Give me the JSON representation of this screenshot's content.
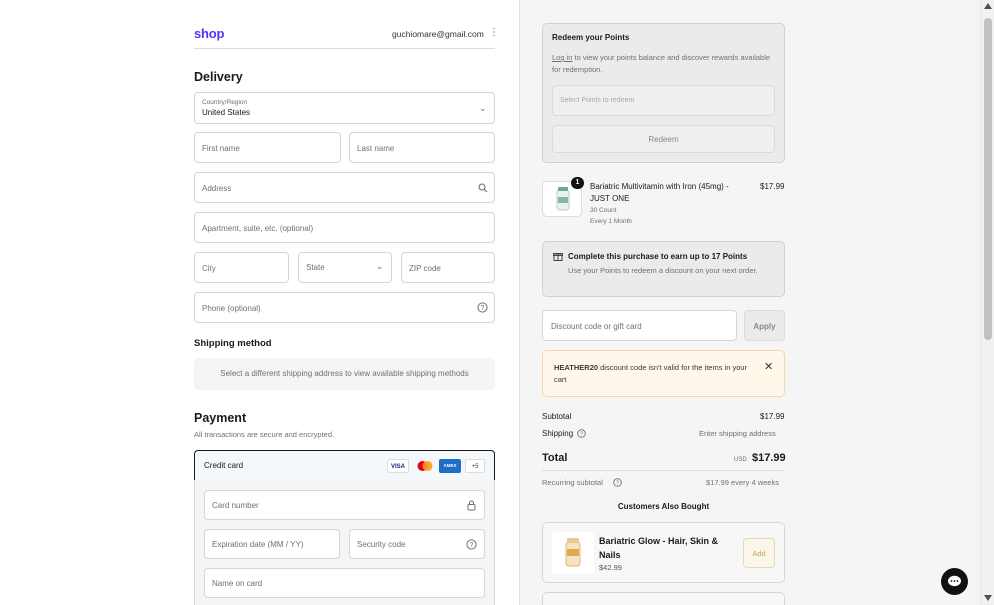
{
  "header": {
    "logo": "shop",
    "email": "guchiomare@gmail.com",
    "menu_icon": "kebab-icon"
  },
  "delivery": {
    "title": "Delivery",
    "country_label": "Country/Region",
    "country_value": "United States",
    "first_name_placeholder": "First name",
    "last_name_placeholder": "Last name",
    "address_placeholder": "Address",
    "apartment_placeholder": "Apartment, suite, etc. (optional)",
    "city_placeholder": "City",
    "state_placeholder": "State",
    "zip_placeholder": "ZIP code",
    "phone_placeholder": "Phone (optional)"
  },
  "shipping": {
    "title": "Shipping method",
    "message": "Select a different shipping address to view available shipping methods"
  },
  "payment": {
    "title": "Payment",
    "subtitle": "All transactions are secure and encrypted.",
    "method_label": "Credit card",
    "card_brands": [
      "VISA",
      "mastercard",
      "AMEX"
    ],
    "more_brands": "+5",
    "card_number_placeholder": "Card number",
    "expiration_placeholder": "Expiration date (MM / YY)",
    "security_code_placeholder": "Security code",
    "name_on_card_placeholder": "Name on card"
  },
  "points": {
    "title": "Redeem your Points",
    "login_link": "Log in",
    "description": " to view your points balance and discover rewards available for redemption.",
    "select_placeholder": "Select Points to redeem",
    "redeem_button": "Redeem"
  },
  "cart_item": {
    "quantity": "1",
    "name": "Bariatric Multivitamin with Iron (45mg) - JUST ONE",
    "variant": "30 Count",
    "frequency": "Every 1 Month",
    "price": "$17.99"
  },
  "earn": {
    "title": "Complete this purchase to earn up to 17 Points",
    "description": "Use your Points to redeem a discount on your next order."
  },
  "discount": {
    "placeholder": "Discount code or gift card",
    "apply_button": "Apply"
  },
  "warning": {
    "code": "HEATHER20",
    "message": " discount code isn't valid for the items in your cart"
  },
  "summary": {
    "subtotal_label": "Subtotal",
    "subtotal_value": "$17.99",
    "shipping_label": "Shipping",
    "shipping_value": "Enter shipping address",
    "total_label": "Total",
    "currency": "USD",
    "total_value": "$17.99",
    "recurring_label": "Recurring subtotal",
    "recurring_value": "$17.99 every 4 weeks"
  },
  "upsell": {
    "title": "Customers Also Bought",
    "product_name": "Bariatric Glow - Hair, Skin & Nails",
    "product_price": "$42.99",
    "add_button": "Add"
  },
  "colors": {
    "shop_brand": "#5a31f4",
    "warning_bg": "#fff8ea",
    "sidebar_bg": "#f5f5f5"
  }
}
